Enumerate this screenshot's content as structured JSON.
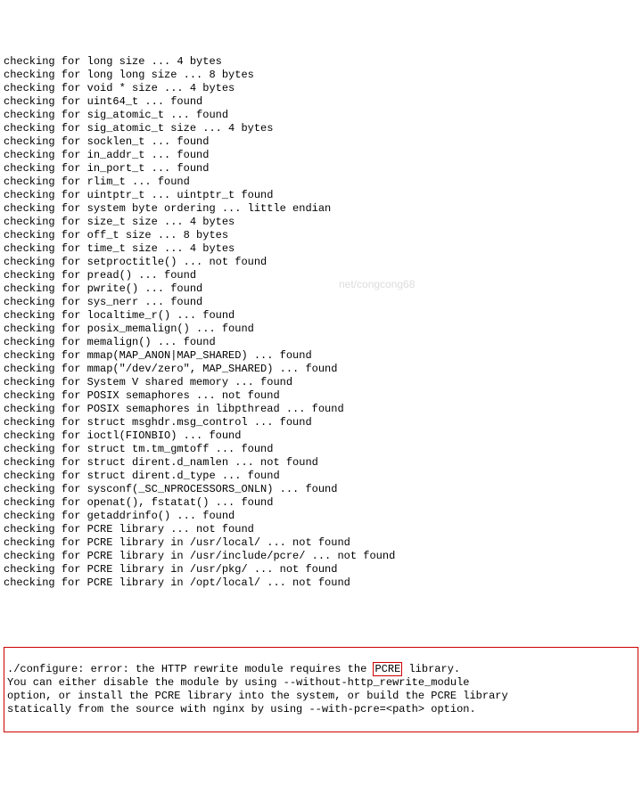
{
  "lines": [
    "checking for long size ... 4 bytes",
    "checking for long long size ... 8 bytes",
    "checking for void * size ... 4 bytes",
    "checking for uint64_t ... found",
    "checking for sig_atomic_t ... found",
    "checking for sig_atomic_t size ... 4 bytes",
    "checking for socklen_t ... found",
    "checking for in_addr_t ... found",
    "checking for in_port_t ... found",
    "checking for rlim_t ... found",
    "checking for uintptr_t ... uintptr_t found",
    "checking for system byte ordering ... little endian",
    "checking for size_t size ... 4 bytes",
    "checking for off_t size ... 8 bytes",
    "checking for time_t size ... 4 bytes",
    "checking for setproctitle() ... not found",
    "checking for pread() ... found",
    "checking for pwrite() ... found",
    "checking for sys_nerr ... found",
    "checking for localtime_r() ... found",
    "checking for posix_memalign() ... found",
    "checking for memalign() ... found",
    "checking for mmap(MAP_ANON|MAP_SHARED) ... found",
    "checking for mmap(\"/dev/zero\", MAP_SHARED) ... found",
    "checking for System V shared memory ... found",
    "checking for POSIX semaphores ... not found",
    "checking for POSIX semaphores in libpthread ... found",
    "checking for struct msghdr.msg_control ... found",
    "checking for ioctl(FIONBIO) ... found",
    "checking for struct tm.tm_gmtoff ... found",
    "checking for struct dirent.d_namlen ... not found",
    "checking for struct dirent.d_type ... found",
    "checking for sysconf(_SC_NPROCESSORS_ONLN) ... found",
    "checking for openat(), fstatat() ... found",
    "checking for getaddrinfo() ... found",
    "checking for PCRE library ... not found",
    "checking for PCRE library in /usr/local/ ... not found",
    "checking for PCRE library in /usr/include/pcre/ ... not found",
    "checking for PCRE library in /usr/pkg/ ... not found",
    "checking for PCRE library in /opt/local/ ... not found"
  ],
  "error": {
    "blank": "",
    "line1_pre": "./configure: error: the HTTP rewrite module requires the ",
    "pcre_word": "PCRE",
    "line1_post": " library.",
    "line2": "You can either disable the module by using --without-http_rewrite_module",
    "line3": "option, or install the PCRE library into the system, or build the PCRE library",
    "line4": "statically from the source with nginx by using --with-pcre=<path> option."
  },
  "watermark": "net/congcong68"
}
